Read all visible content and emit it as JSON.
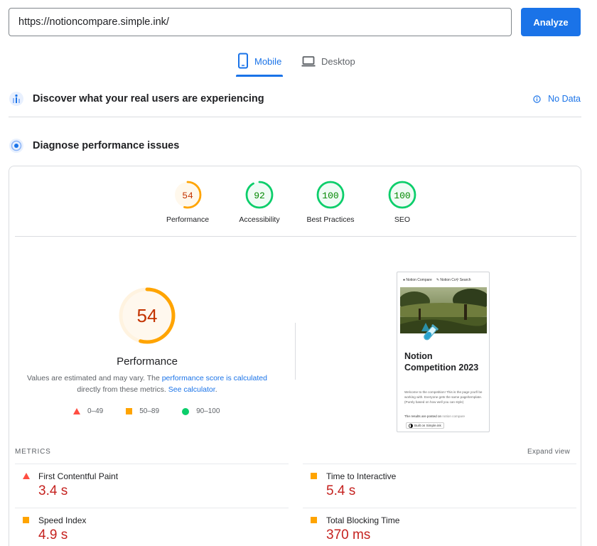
{
  "search": {
    "url": "https://notioncompare.simple.ink/",
    "analyze_label": "Analyze"
  },
  "tabs": {
    "mobile": "Mobile",
    "desktop": "Desktop"
  },
  "field_data": {
    "title": "Discover what your real users are experiencing",
    "no_data": "No Data"
  },
  "diagnose": {
    "title": "Diagnose performance issues"
  },
  "scores": [
    {
      "label": "Performance",
      "value": 54,
      "rating": "average"
    },
    {
      "label": "Accessibility",
      "value": 92,
      "rating": "pass"
    },
    {
      "label": "Best Practices",
      "value": 100,
      "rating": "pass"
    },
    {
      "label": "SEO",
      "value": 100,
      "rating": "pass"
    }
  ],
  "main_gauge": {
    "value": "54",
    "label": "Performance",
    "note_prefix": "Values are estimated and may vary. The ",
    "note_link1": "performance score is calculated",
    "note_mid": " directly from these metrics. ",
    "note_link2": "See calculator",
    "note_suffix": "."
  },
  "legend": {
    "fail": "0–49",
    "average": "50–89",
    "pass": "90–100"
  },
  "screenshot": {
    "nav1": "Notion Compare",
    "nav2": "Notion Co",
    "nav3": "Search",
    "title": "Notion Competition 2023",
    "body": "Welcome to the competition! This is the page you'll be working with. Everyone gets the same page/template. (Purely based on how well you can style)",
    "body2_prefix": "The results are posted on ",
    "body2_link": "notion compare",
    "built": "Built on Simple.ink"
  },
  "metrics": {
    "title": "METRICS",
    "expand": "Expand view",
    "fcp": {
      "name": "First Contentful Paint",
      "value": "3.4 s",
      "rating": "fail"
    },
    "tti": {
      "name": "Time to Interactive",
      "value": "5.4 s",
      "rating": "average"
    },
    "si": {
      "name": "Speed Index",
      "value": "4.9 s",
      "rating": "average"
    },
    "tbt": {
      "name": "Total Blocking Time",
      "value": "370 ms",
      "rating": "average"
    }
  },
  "colors": {
    "accent": "#1a73e8",
    "pass": "#0cce6b",
    "average": "#ffa400",
    "fail": "#ff4e42",
    "fail_text": "#c5221f"
  }
}
